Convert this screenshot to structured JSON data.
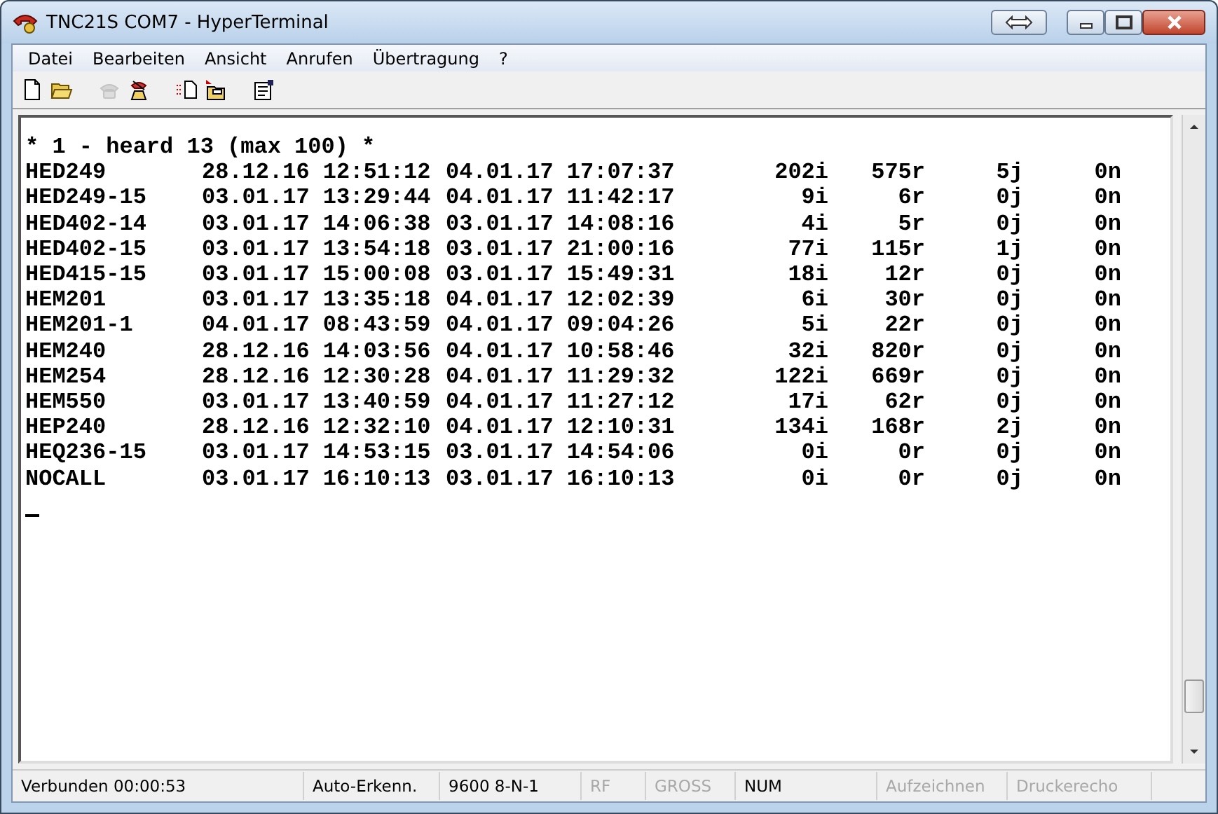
{
  "window": {
    "title": "TNC21S COM7 - HyperTerminal"
  },
  "menu": [
    {
      "label": "Datei"
    },
    {
      "label": "Bearbeiten"
    },
    {
      "label": "Ansicht"
    },
    {
      "label": "Anrufen"
    },
    {
      "label": "Übertragung"
    },
    {
      "label": "?"
    }
  ],
  "toolbar": [
    {
      "kind": "new",
      "disabled": false
    },
    {
      "kind": "open",
      "disabled": false
    },
    {
      "kind": "sep"
    },
    {
      "kind": "call",
      "disabled": true
    },
    {
      "kind": "disconnect",
      "disabled": false
    },
    {
      "kind": "sep"
    },
    {
      "kind": "send",
      "disabled": false
    },
    {
      "kind": "receive",
      "disabled": false
    },
    {
      "kind": "sep"
    },
    {
      "kind": "properties",
      "disabled": false
    }
  ],
  "terminal": {
    "header": "* 1 - heard 13 (max 100) *",
    "rows": [
      {
        "callsign": "HED249",
        "first_heard": "28.12.16 12:51:12",
        "last_heard": "04.01.17 17:07:37",
        "i": "202i",
        "r": "575r",
        "j": "5j",
        "n": "0n"
      },
      {
        "callsign": "HED249-15",
        "first_heard": "03.01.17 13:29:44",
        "last_heard": "04.01.17 11:42:17",
        "i": "9i",
        "r": "6r",
        "j": "0j",
        "n": "0n"
      },
      {
        "callsign": "HED402-14",
        "first_heard": "03.01.17 14:06:38",
        "last_heard": "03.01.17 14:08:16",
        "i": "4i",
        "r": "5r",
        "j": "0j",
        "n": "0n"
      },
      {
        "callsign": "HED402-15",
        "first_heard": "03.01.17 13:54:18",
        "last_heard": "03.01.17 21:00:16",
        "i": "77i",
        "r": "115r",
        "j": "1j",
        "n": "0n"
      },
      {
        "callsign": "HED415-15",
        "first_heard": "03.01.17 15:00:08",
        "last_heard": "03.01.17 15:49:31",
        "i": "18i",
        "r": "12r",
        "j": "0j",
        "n": "0n"
      },
      {
        "callsign": "HEM201",
        "first_heard": "03.01.17 13:35:18",
        "last_heard": "04.01.17 12:02:39",
        "i": "6i",
        "r": "30r",
        "j": "0j",
        "n": "0n"
      },
      {
        "callsign": "HEM201-1",
        "first_heard": "04.01.17 08:43:59",
        "last_heard": "04.01.17 09:04:26",
        "i": "5i",
        "r": "22r",
        "j": "0j",
        "n": "0n"
      },
      {
        "callsign": "HEM240",
        "first_heard": "28.12.16 14:03:56",
        "last_heard": "04.01.17 10:58:46",
        "i": "32i",
        "r": "820r",
        "j": "0j",
        "n": "0n"
      },
      {
        "callsign": "HEM254",
        "first_heard": "28.12.16 12:30:28",
        "last_heard": "04.01.17 11:29:32",
        "i": "122i",
        "r": "669r",
        "j": "0j",
        "n": "0n"
      },
      {
        "callsign": "HEM550",
        "first_heard": "03.01.17 13:40:59",
        "last_heard": "04.01.17 11:27:12",
        "i": "17i",
        "r": "62r",
        "j": "0j",
        "n": "0n"
      },
      {
        "callsign": "HEP240",
        "first_heard": "28.12.16 12:32:10",
        "last_heard": "04.01.17 12:10:31",
        "i": "134i",
        "r": "168r",
        "j": "2j",
        "n": "0n"
      },
      {
        "callsign": "HEQ236-15",
        "first_heard": "03.01.17 14:53:15",
        "last_heard": "03.01.17 14:54:06",
        "i": "0i",
        "r": "0r",
        "j": "0j",
        "n": "0n"
      },
      {
        "callsign": "NOCALL",
        "first_heard": "03.01.17 16:10:13",
        "last_heard": "03.01.17 16:10:13",
        "i": "0i",
        "r": "0r",
        "j": "0j",
        "n": "0n"
      }
    ]
  },
  "status_bar": [
    {
      "text": "Verbunden 00:00:53",
      "disabled": false
    },
    {
      "text": "Auto-Erkenn.",
      "disabled": false
    },
    {
      "text": "9600 8-N-1",
      "disabled": false
    },
    {
      "text": "RF",
      "disabled": true
    },
    {
      "text": "GROSS",
      "disabled": true
    },
    {
      "text": "NUM",
      "disabled": false
    },
    {
      "text": "Aufzeichnen",
      "disabled": true
    },
    {
      "text": "Druckerecho",
      "disabled": true
    }
  ]
}
